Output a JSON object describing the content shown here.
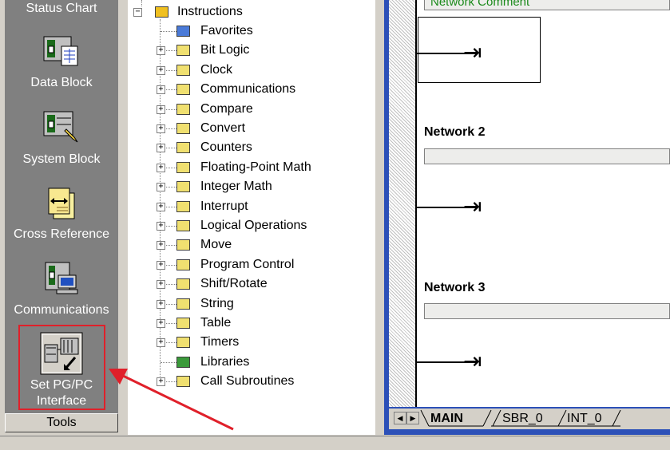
{
  "navbar": {
    "items": [
      {
        "label": "Status Chart",
        "icon": "status-chart-icon"
      },
      {
        "label": "Data Block",
        "icon": "data-block-icon"
      },
      {
        "label": "System Block",
        "icon": "system-block-icon"
      },
      {
        "label": "Cross Reference",
        "icon": "cross-reference-icon"
      },
      {
        "label": "Communications",
        "icon": "communications-icon"
      },
      {
        "label_line1": "Set PG/PC",
        "label_line2": "Interface",
        "icon": "set-pg-pc-interface-icon"
      }
    ],
    "tools_label": "Tools"
  },
  "tree": {
    "root": "Instructions",
    "items": [
      {
        "label": "Favorites",
        "icon": "favorites-icon",
        "expandable": false
      },
      {
        "label": "Bit Logic",
        "icon": "bit-logic-icon",
        "expandable": true
      },
      {
        "label": "Clock",
        "icon": "clock-icon",
        "expandable": true
      },
      {
        "label": "Communications",
        "icon": "communications-icon",
        "expandable": true
      },
      {
        "label": "Compare",
        "icon": "compare-icon",
        "expandable": true
      },
      {
        "label": "Convert",
        "icon": "convert-icon",
        "expandable": true
      },
      {
        "label": "Counters",
        "icon": "counters-icon",
        "expandable": true
      },
      {
        "label": "Floating-Point Math",
        "icon": "floating-point-icon",
        "expandable": true
      },
      {
        "label": "Integer Math",
        "icon": "integer-math-icon",
        "expandable": true
      },
      {
        "label": "Interrupt",
        "icon": "interrupt-icon",
        "expandable": true
      },
      {
        "label": "Logical Operations",
        "icon": "logical-ops-icon",
        "expandable": true
      },
      {
        "label": "Move",
        "icon": "move-icon",
        "expandable": true
      },
      {
        "label": "Program Control",
        "icon": "program-control-icon",
        "expandable": true
      },
      {
        "label": "Shift/Rotate",
        "icon": "shift-rotate-icon",
        "expandable": true
      },
      {
        "label": "String",
        "icon": "string-icon",
        "expandable": true
      },
      {
        "label": "Table",
        "icon": "table-icon",
        "expandable": true
      },
      {
        "label": "Timers",
        "icon": "timers-icon",
        "expandable": true
      },
      {
        "label": "Libraries",
        "icon": "libraries-icon",
        "expandable": false
      },
      {
        "label": "Call Subroutines",
        "icon": "call-subroutines-icon",
        "expandable": true
      }
    ]
  },
  "editor": {
    "network_comment": "Network Comment",
    "networks": [
      {
        "title": "Network 2"
      },
      {
        "title": "Network 3"
      }
    ],
    "tabs": [
      "MAIN",
      "SBR_0",
      "INT_0"
    ],
    "active_tab": "MAIN"
  },
  "colors": {
    "highlight": "#e0202a",
    "arrow": "#e0202a",
    "editor_frame": "#2c50b8",
    "nav_panel": "#808080"
  }
}
